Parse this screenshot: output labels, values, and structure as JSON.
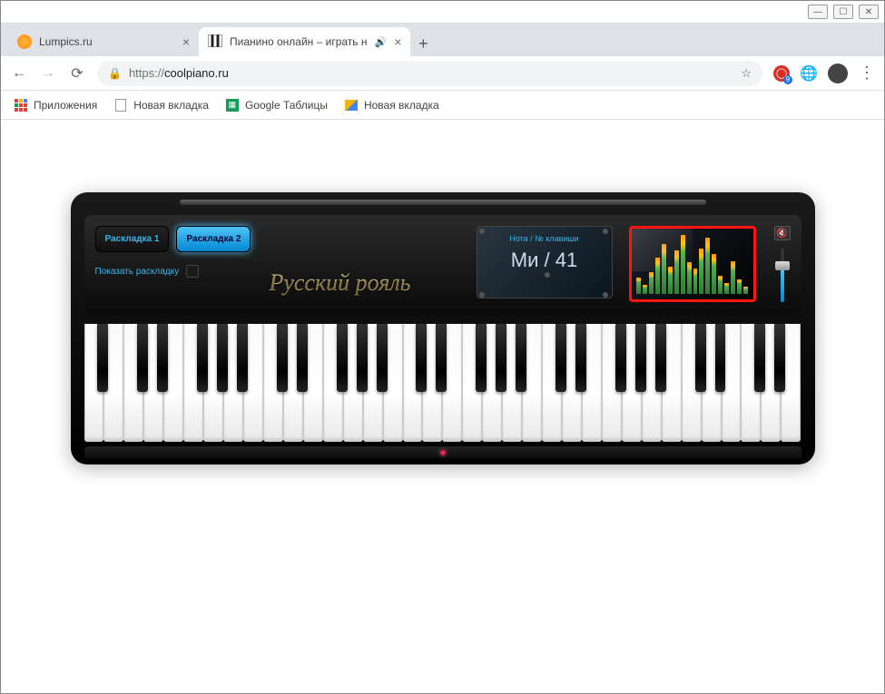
{
  "window_controls": {
    "minimize": "—",
    "maximize": "☐",
    "close": "✕"
  },
  "tabs": [
    {
      "title": "Lumpics.ru",
      "active": false,
      "favicon": "orange"
    },
    {
      "title": "Пианино онлайн – играть н",
      "active": true,
      "favicon": "piano",
      "audio": true
    }
  ],
  "address": {
    "scheme": "https://",
    "host": "coolpiano.ru",
    "display_prefix": "https://"
  },
  "bookmarks": [
    {
      "label": "Приложения",
      "icon": "apps"
    },
    {
      "label": "Новая вкладка",
      "icon": "doc"
    },
    {
      "label": "Google Таблицы",
      "icon": "sheets"
    },
    {
      "label": "Новая вкладка",
      "icon": "img"
    }
  ],
  "piano": {
    "layout1": "Раскладка 1",
    "layout2": "Раскладка 2",
    "show_layout": "Показать раскладку",
    "title": "Русский рояль",
    "lcd_label": "Нота / № клавиши",
    "lcd_value": "Ми / 41",
    "visualizer_bars": [
      18,
      10,
      24,
      40,
      55,
      30,
      48,
      65,
      35,
      28,
      50,
      62,
      44,
      20,
      12,
      36,
      16,
      8
    ],
    "volume_percent": 63,
    "octaves": [
      {
        "pattern": "partial_start"
      },
      {
        "pattern": "full"
      },
      {
        "pattern": "full"
      },
      {
        "pattern": "full"
      },
      {
        "pattern": "full"
      },
      {
        "pattern": "full"
      },
      {
        "pattern": "partial_end"
      }
    ]
  }
}
